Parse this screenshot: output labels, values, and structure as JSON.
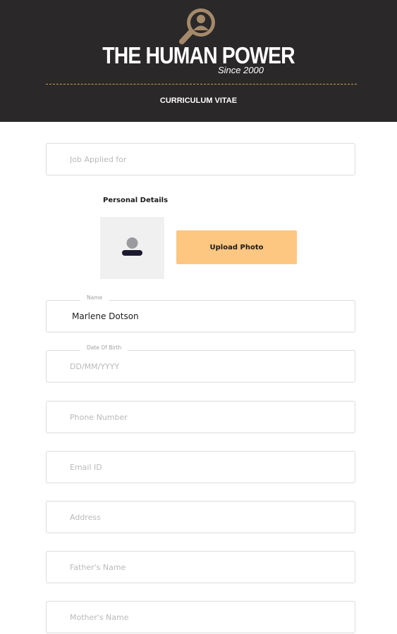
{
  "header": {
    "brand_title": "THE HUMAN POWER",
    "brand_since": "Since 2000",
    "subtitle": "CURRICULUM VITAE",
    "logo_icon": "user-magnifier-icon",
    "bg_color": "#2b2829",
    "accent_color": "#c7a14a"
  },
  "form": {
    "job_applied": {
      "placeholder": "Job Applied for",
      "value": ""
    },
    "personal_details": {
      "title": "Personal Details",
      "photo_placeholder_icon": "avatar-placeholder-icon",
      "upload_label": "Upload Photo",
      "upload_color": "#fdc681"
    },
    "name": {
      "label": "Name",
      "value": "Marlene Dotson"
    },
    "dob": {
      "label": "Date Of Birth",
      "placeholder": "DD/MM/YYYY",
      "value": ""
    },
    "phone": {
      "placeholder": "Phone Number"
    },
    "email": {
      "placeholder": "Email ID"
    },
    "address": {
      "placeholder": "Address"
    },
    "father": {
      "placeholder": "Father's Name"
    },
    "mother": {
      "placeholder": "Mother's Name"
    }
  }
}
